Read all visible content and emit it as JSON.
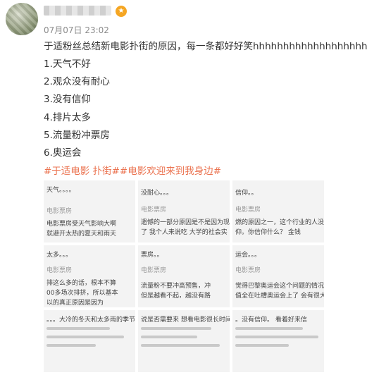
{
  "post": {
    "time": "07月07日 23:02",
    "text": "于适粉丝总结新电影扑街的原因，每一条都好好笑hhhhhhhhhhhhhhhhhhh",
    "reasons": [
      "1.天气不好",
      "2.观众没有耐心",
      "3.没有信仰",
      "4.排片太多",
      "5.流量粉冲票房",
      "6.奥运会"
    ],
    "hashtags": "#于适电影 扑街##电影欢迎来到我身边#"
  },
  "images": [
    {
      "lines": [
        "天气。。。。",
        "电影票房",
        "电影票房受天气影响大啊",
        "就避开太热的夏天和雨天",
        "。。。大冷的冬天和太多雨的季节"
      ]
    },
    {
      "lines": [
        "没耐心。。。",
        "电影票房",
        "遗憾的一部分原因是不是因为现在人很",
        "了 我个人来说吃 大学的社会实",
        "说是否需要来 想看电影很长时间"
      ]
    },
    {
      "lines": [
        "信仰。。",
        "电影票房",
        "燃的原因之一，这个行业的人没有",
        "仰。你信仰什么？ 金钱",
        "。没有信仰。 看着好来信"
      ]
    },
    {
      "lines": [
        "太多。。。",
        "电影票房",
        "排这么多的话，根本不算",
        "00多场次排挤，所以基本",
        "以的真正原因是因为"
      ]
    },
    {
      "lines": [
        "票房。。",
        "电影票房",
        "流量粉不要冲高预售，冲",
        "但是越看不起，越没有路",
        ""
      ]
    },
    {
      "lines": [
        "运会。。。",
        "电影票房",
        "觉得巴黎奥运会这个问题的情况",
        "值全在吐槽奥运会上了 会有很大",
        ""
      ]
    }
  ]
}
